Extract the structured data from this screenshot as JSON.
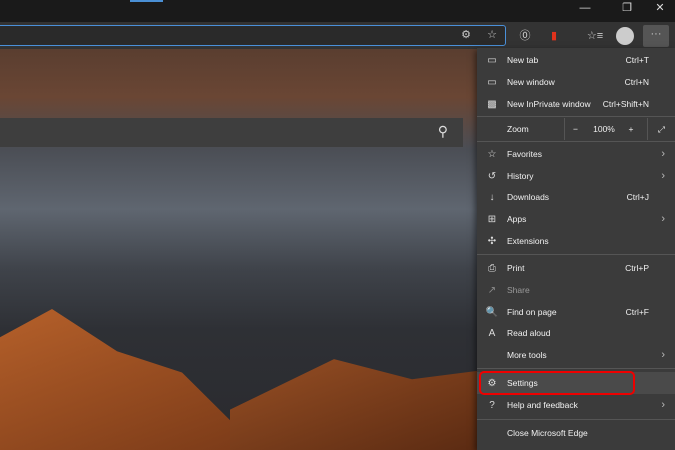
{
  "window": {
    "minimize": "—",
    "restore": "❐",
    "close": "✕"
  },
  "toolbar": {
    "reader_icon": "⓪",
    "office_icon": "▮",
    "favorites_icon": "☆≡",
    "more_label": "···"
  },
  "menu": {
    "top": [
      {
        "label": "New tab",
        "shortcut": "Ctrl+T",
        "icon": "▭"
      },
      {
        "label": "New window",
        "shortcut": "Ctrl+N",
        "icon": "▭"
      },
      {
        "label": "New InPrivate window",
        "shortcut": "Ctrl+Shift+N",
        "icon": "▩"
      }
    ],
    "zoom": {
      "label": "Zoom",
      "minus": "−",
      "value": "100%",
      "plus": "+",
      "fullscreen": "⤢"
    },
    "group2": [
      {
        "label": "Favorites",
        "icon": "☆",
        "sub": true
      },
      {
        "label": "History",
        "icon": "↺",
        "sub": true
      },
      {
        "label": "Downloads",
        "shortcut": "Ctrl+J",
        "icon": "↓"
      },
      {
        "label": "Apps",
        "icon": "⊞",
        "sub": true
      },
      {
        "label": "Extensions",
        "icon": "✣"
      }
    ],
    "group3": [
      {
        "label": "Print",
        "shortcut": "Ctrl+P",
        "icon": "⎙"
      },
      {
        "label": "Share",
        "icon": "↗"
      },
      {
        "label": "Find on page",
        "shortcut": "Ctrl+F",
        "icon": "🔍"
      },
      {
        "label": "Read aloud",
        "icon": "A"
      },
      {
        "label": "More tools",
        "sub": true
      }
    ],
    "settings": {
      "label": "Settings",
      "icon": "⚙"
    },
    "help": {
      "label": "Help and feedback",
      "icon": "?"
    },
    "close": {
      "label": "Close Microsoft Edge"
    }
  },
  "chevron": "›"
}
